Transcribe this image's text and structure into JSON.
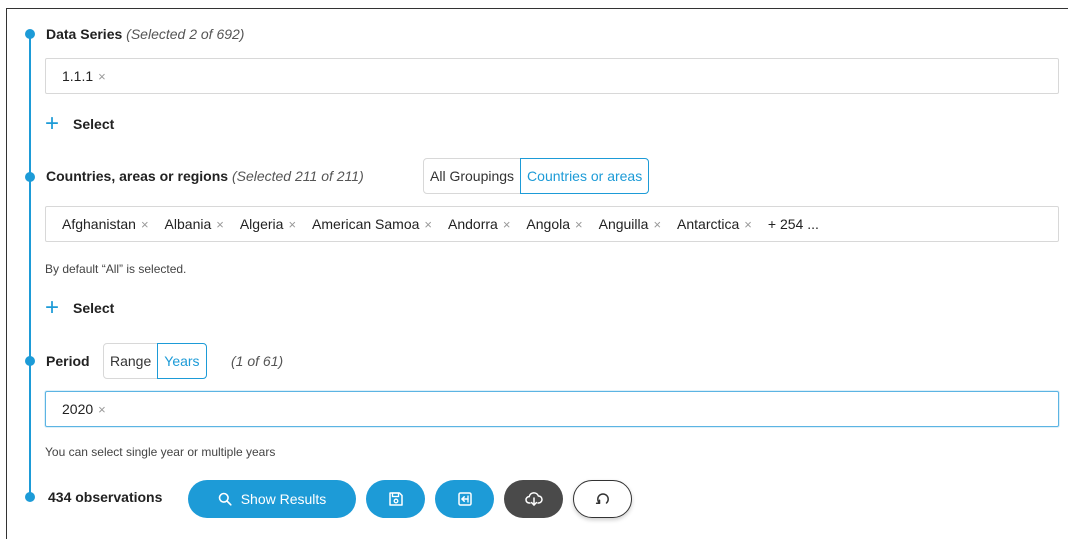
{
  "data_series": {
    "label": "Data Series",
    "meta": "(Selected 2 of 692)",
    "tags": [
      "1.1.1"
    ],
    "select_label": "Select"
  },
  "countries": {
    "label": "Countries, areas or regions",
    "meta": "(Selected 211 of 211)",
    "toggles": [
      "All Groupings",
      "Countries or areas"
    ],
    "active_toggle": "Countries or areas",
    "tags": [
      "Afghanistan",
      "Albania",
      "Algeria",
      "American Samoa",
      "Andorra",
      "Angola",
      "Anguilla",
      "Antarctica"
    ],
    "more": "+ 254 ...",
    "hint": "By default “All” is selected.",
    "select_label": "Select"
  },
  "period": {
    "label": "Period",
    "toggles": [
      "Range",
      "Years"
    ],
    "active_toggle": "Years",
    "count": "(1 of 61)",
    "tags": [
      "2020"
    ],
    "hint": "You can select single year or multiple years"
  },
  "footer": {
    "observations": "434 observations",
    "show_results_label": "Show Results",
    "icons": [
      "search-icon",
      "save-icon",
      "export-icon",
      "cloud-download-icon",
      "reset-icon"
    ]
  },
  "colors": {
    "accent": "#1d9bd7",
    "dark_button": "#4a4a4a"
  },
  "tag_remove_glyph": "×",
  "plus_glyph": "+"
}
